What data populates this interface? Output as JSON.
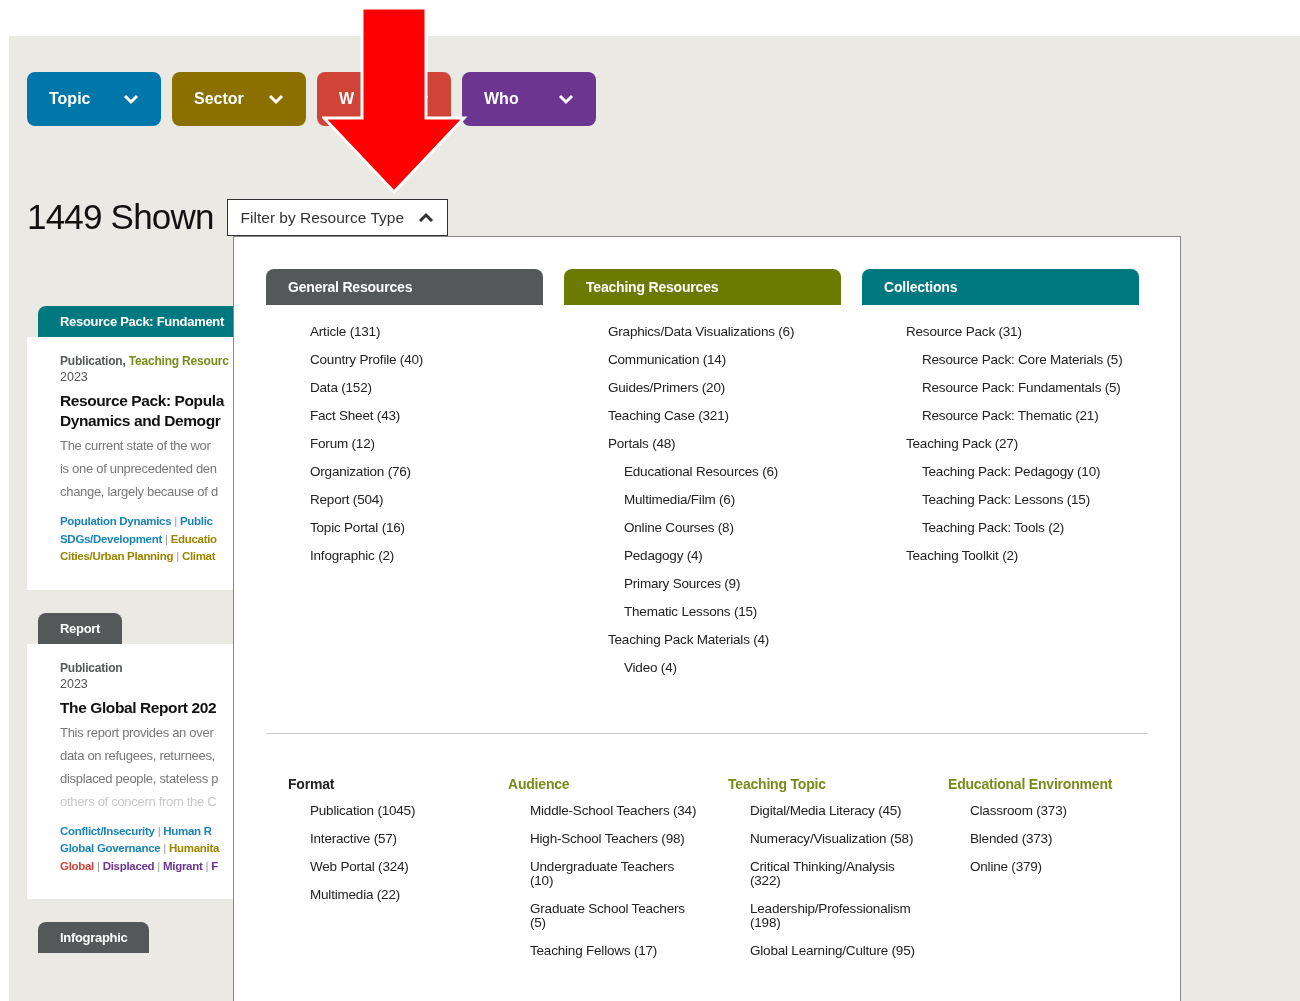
{
  "filters": [
    {
      "label": "Topic",
      "color": "#0077a8"
    },
    {
      "label": "Sector",
      "color": "#8b7000"
    },
    {
      "label": "W",
      "color": "#d04437"
    },
    {
      "label": "Who",
      "color": "#6b3590"
    }
  ],
  "count_title": "1449 Shown",
  "resource_filter": {
    "label": "Filter by Resource Type",
    "expanded": true
  },
  "cards": [
    {
      "tab": "Resource Pack: Fundament",
      "color": "#00787f",
      "meta": [
        {
          "text": "Publication",
          "color": "#555858"
        },
        {
          "text": ", "
        },
        {
          "text": "Teaching Resourc",
          "color": "#7a8a1a"
        }
      ],
      "year": "2023",
      "title_lines": [
        "Resource Pack: Popula",
        "Dynamics and Demogr"
      ],
      "description": [
        "The current state of the wor",
        "is one of unprecedented den",
        "change, largely because of d"
      ],
      "separator": "|",
      "tags": [
        [
          {
            "text": "Population Dynamics",
            "color": "#1a84b8"
          },
          {
            "text": "Public",
            "color": "#1a84b8"
          }
        ],
        [
          {
            "text": "SDGs/Development",
            "color": "#1a84b8"
          },
          {
            "text": "Educatio",
            "color": "#9a8500"
          }
        ],
        [
          {
            "text": "Cities/Urban Planning",
            "color": "#9a8500"
          },
          {
            "text": "Climat",
            "color": "#9a8500"
          }
        ]
      ]
    },
    {
      "tab": "Report",
      "color": "#555858",
      "meta": [
        {
          "text": "Publication",
          "color": "#555858"
        }
      ],
      "year": "2023",
      "title_lines": [
        "The Global Report 202"
      ],
      "description": [
        "This report provides an over",
        "data on refugees, returnees,",
        "displaced people, stateless p"
      ],
      "faded": [
        "others of concern from the C"
      ],
      "separator": "|",
      "tags": [
        [
          {
            "text": "Conflict/Insecurity",
            "color": "#1a84b8"
          },
          {
            "text": "Human R",
            "color": "#1a84b8"
          }
        ],
        [
          {
            "text": "Global Governance",
            "color": "#1a84b8"
          },
          {
            "text": "Humanita",
            "color": "#9a8500"
          }
        ],
        [
          {
            "text": "Global",
            "color": "#d04437"
          },
          {
            "text": "Displaced",
            "color": "#6b3590"
          },
          {
            "text": "Migrant",
            "color": "#6b3590"
          },
          {
            "text": "F",
            "color": "#6b3590"
          }
        ]
      ]
    },
    {
      "tab": "Infographic",
      "color": "#555858"
    }
  ],
  "panel": {
    "sections": [
      {
        "title": "General Resources",
        "color": "#555858",
        "items": [
          {
            "label": "Article (131)"
          },
          {
            "label": "Country Profile (40)"
          },
          {
            "label": "Data (152)"
          },
          {
            "label": "Fact Sheet (43)"
          },
          {
            "label": "Forum (12)"
          },
          {
            "label": "Organization (76)"
          },
          {
            "label": "Report (504)"
          },
          {
            "label": "Topic Portal (16)"
          },
          {
            "label": "Infographic (2)"
          }
        ]
      },
      {
        "title": "Teaching Resources",
        "color": "#6b7a00",
        "items": [
          {
            "label": "Graphics/Data Visualizations (6)"
          },
          {
            "label": "Communication (14)"
          },
          {
            "label": "Guides/Primers (20)"
          },
          {
            "label": "Teaching Case (321)"
          },
          {
            "label": "Portals (48)",
            "children": [
              {
                "label": "Educational Resources (6)"
              },
              {
                "label": "Multimedia/Film (6)"
              },
              {
                "label": "Online Courses (8)"
              },
              {
                "label": "Pedagogy (4)"
              },
              {
                "label": "Primary Sources (9)"
              },
              {
                "label": "Thematic Lessons (15)"
              }
            ]
          },
          {
            "label": "Teaching Pack Materials (4)",
            "children": [
              {
                "label": "Video (4)"
              }
            ]
          }
        ]
      },
      {
        "title": "Collections",
        "color": "#00787f",
        "items": [
          {
            "label": "Resource Pack (31)",
            "children": [
              {
                "label": "Resource Pack: Core Materials (5)"
              },
              {
                "label": "Resource Pack: Fundamentals (5)"
              },
              {
                "label": "Resource Pack: Thematic (21)"
              }
            ]
          },
          {
            "label": "Teaching Pack (27)",
            "children": [
              {
                "label": "Teaching Pack: Pedagogy (10)"
              },
              {
                "label": "Teaching Pack: Lessons (15)"
              },
              {
                "label": "Teaching Pack: Tools (2)"
              }
            ]
          },
          {
            "label": "Teaching Toolkit (2)"
          }
        ]
      }
    ],
    "groups": [
      {
        "title": "Format",
        "color": "#222222",
        "items": [
          "Publication (1045)",
          "Interactive (57)",
          "Web Portal (324)",
          "Multimedia (22)"
        ]
      },
      {
        "title": "Audience",
        "color": "#7a8a1a",
        "items": [
          "Middle-School Teachers (34)",
          "High-School Teachers (98)",
          "Undergraduate Teachers (10)",
          "Graduate School Teachers (5)",
          "Teaching Fellows (17)"
        ]
      },
      {
        "title": "Teaching Topic",
        "color": "#7a8a1a",
        "items": [
          "Digital/Media Literacy (45)",
          "Numeracy/Visualization (58)",
          "Critical Thinking/Analysis (322)",
          "Leadership/Professionalism (198)",
          "Global Learning/Culture (95)"
        ]
      },
      {
        "title": "Educational Environment",
        "color": "#7a8a1a",
        "items": [
          "Classroom (373)",
          "Blended (373)",
          "Online (379)"
        ]
      }
    ]
  }
}
